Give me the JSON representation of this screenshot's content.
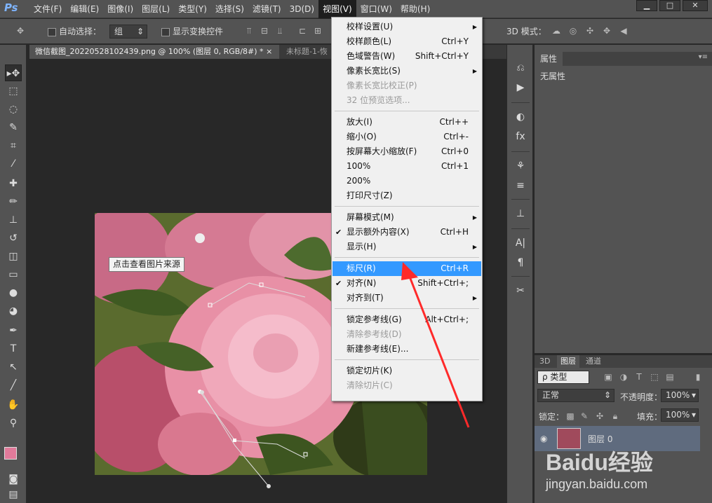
{
  "app": {
    "logo": "Ps"
  },
  "menubar": {
    "items": [
      "文件(F)",
      "编辑(E)",
      "图像(I)",
      "图层(L)",
      "类型(Y)",
      "选择(S)",
      "滤镜(T)",
      "3D(D)",
      "视图(V)",
      "窗口(W)",
      "帮助(H)"
    ],
    "active": "视图(V)"
  },
  "window_buttons": {
    "minimize": "▁",
    "restore": "□",
    "close": "✕"
  },
  "options_bar": {
    "auto_select_label": "自动选择：",
    "auto_select_value": "组",
    "transform_label": "显示变换控件",
    "mode_3d_label": "3D 模式："
  },
  "tabs": [
    {
      "label": "微信截图_20220528102439.png @ 100% (图层 0, RGB/8#) *",
      "close": "×"
    },
    {
      "label": "未标题-1-恢"
    }
  ],
  "view_menu": {
    "items": [
      {
        "label": "校样设置(U)",
        "shortcut": "",
        "submenu": true
      },
      {
        "label": "校样颜色(L)",
        "shortcut": "Ctrl+Y"
      },
      {
        "label": "色域警告(W)",
        "shortcut": "Shift+Ctrl+Y"
      },
      {
        "label": "像素长宽比(S)",
        "shortcut": "",
        "submenu": true
      },
      {
        "label": "像素长宽比校正(P)",
        "shortcut": "",
        "disabled": true
      },
      {
        "label": "32 位预览选项...",
        "shortcut": "",
        "disabled": true
      },
      {
        "label": "放大(I)",
        "shortcut": "Ctrl++"
      },
      {
        "label": "缩小(O)",
        "shortcut": "Ctrl+-"
      },
      {
        "label": "按屏幕大小缩放(F)",
        "shortcut": "Ctrl+0"
      },
      {
        "label": "100%",
        "shortcut": "Ctrl+1"
      },
      {
        "label": "200%",
        "shortcut": ""
      },
      {
        "label": "打印尺寸(Z)",
        "shortcut": ""
      },
      {
        "label": "屏幕模式(M)",
        "shortcut": "",
        "submenu": true
      },
      {
        "label": "显示额外内容(X)",
        "shortcut": "Ctrl+H",
        "checked": true
      },
      {
        "label": "显示(H)",
        "shortcut": "",
        "submenu": true
      },
      {
        "label": "标尺(R)",
        "shortcut": "Ctrl+R",
        "highlighted": true
      },
      {
        "label": "对齐(N)",
        "shortcut": "Shift+Ctrl+;",
        "checked": true
      },
      {
        "label": "对齐到(T)",
        "shortcut": "",
        "submenu": true
      },
      {
        "label": "锁定参考线(G)",
        "shortcut": "Alt+Ctrl+;"
      },
      {
        "label": "清除参考线(D)",
        "shortcut": "",
        "disabled": true
      },
      {
        "label": "新建参考线(E)...",
        "shortcut": ""
      },
      {
        "label": "锁定切片(K)",
        "shortcut": ""
      },
      {
        "label": "清除切片(C)",
        "shortcut": "",
        "disabled": true
      }
    ],
    "check": "✔",
    "arrow": "▶"
  },
  "canvas": {
    "tooltip": "点击查看图片来源"
  },
  "properties_panel": {
    "title": "属性",
    "body": "无属性"
  },
  "layers_panel": {
    "tabs": [
      "3D",
      "图层",
      "通道"
    ],
    "active_tab": "图层",
    "filter_label": "ρ 类型",
    "blend_mode": "正常",
    "opacity_label": "不透明度：",
    "opacity_value": "100%",
    "lock_label": "锁定：",
    "fill_label": "填充：",
    "fill_value": "100%",
    "layer_name": "图层 0"
  },
  "watermark": {
    "text": "Baidu经验",
    "url": "jingyan.baidu.com"
  },
  "colors": {
    "accent_highlight": "#3399ff",
    "arrow_red": "#ff2a2a",
    "foreground_swatch": "#e07a9a"
  }
}
